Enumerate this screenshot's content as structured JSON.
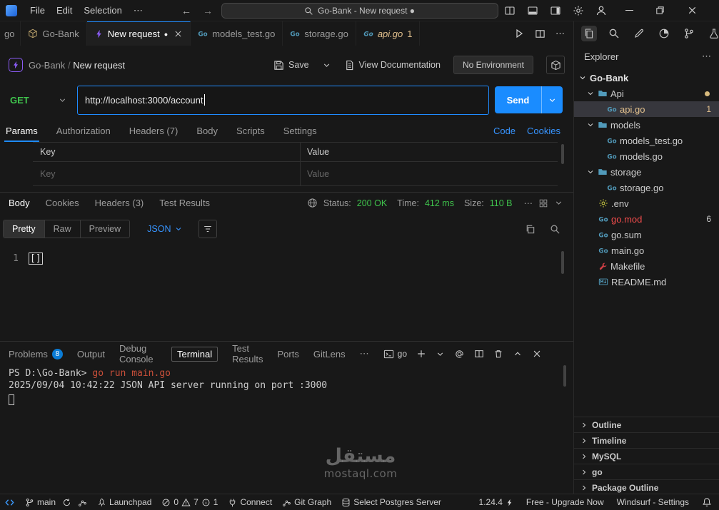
{
  "glyphs": {
    "ellipsis": "⋯",
    "back": "←",
    "forward": "→"
  },
  "colors": {
    "accent_blue": "#1f8bff",
    "link_blue": "#3794ff",
    "green": "#3fc24c",
    "gold_modified": "#e2c08d",
    "error_red": "#f14c4c",
    "purple_bolt": "#8b5cf6",
    "file_icon_blue": "#519aba",
    "env_yellow": "#cbcb41",
    "makefile_red": "#cc3e44"
  },
  "titlebar": {
    "menus": [
      "File",
      "Edit",
      "Selection"
    ],
    "search_text": "Go-Bank - New request ●"
  },
  "editor_tabs": {
    "overflow_fragment": "go",
    "tabs": [
      {
        "label": "Go-Bank"
      },
      {
        "label": "New request",
        "modified": "●"
      },
      {
        "label": "models_test.go"
      },
      {
        "label": "storage.go"
      },
      {
        "label": "api.go",
        "badge": "1"
      }
    ]
  },
  "header": {
    "breadcrumb_project": "Go-Bank",
    "breadcrumb_separator": "/",
    "breadcrumb_page": "New request",
    "save_label": "Save",
    "view_documentation_label": "View Documentation",
    "environment_label": "No Environment"
  },
  "request": {
    "method": "GET",
    "url": "http://localhost:3000/account",
    "send_label": "Send"
  },
  "request_tabs": {
    "tabs": [
      "Params",
      "Authorization",
      "Headers (7)",
      "Body",
      "Scripts",
      "Settings"
    ],
    "code_link": "Code",
    "cookies_link": "Cookies"
  },
  "params_table": {
    "key_header": "Key",
    "value_header": "Value",
    "key_placeholder": "Key",
    "value_placeholder": "Value"
  },
  "response": {
    "tabs": [
      "Body",
      "Cookies",
      "Headers (3)",
      "Test Results"
    ],
    "status_label": "Status:",
    "status_value": "200 OK",
    "time_label": "Time:",
    "time_value": "412 ms",
    "size_label": "Size:",
    "size_value": "110 B",
    "view_modes": [
      "Pretty",
      "Raw",
      "Preview"
    ],
    "format_selector": "JSON",
    "line_number": "1",
    "body_text": "[]"
  },
  "bottom_panel": {
    "tabs": [
      "Problems",
      "Output",
      "Debug Console",
      "Terminal",
      "Test Results",
      "Ports",
      "GitLens"
    ],
    "problems_badge": "8",
    "shell_label": "go",
    "terminal": {
      "prompt": "PS D:\\Go-Bank> ",
      "command": "go run main.go",
      "log_line": "2025/09/04 10:42:22 JSON API server running on port :3000"
    }
  },
  "explorer": {
    "title": "Explorer",
    "root": "Go-Bank",
    "items": [
      {
        "label": "Api"
      },
      {
        "label": "api.go",
        "badge": "1"
      },
      {
        "label": "models"
      },
      {
        "label": "models_test.go"
      },
      {
        "label": "models.go"
      },
      {
        "label": "storage"
      },
      {
        "label": "storage.go"
      },
      {
        "label": ".env"
      },
      {
        "label": "go.mod",
        "badge": "6"
      },
      {
        "label": "go.sum"
      },
      {
        "label": "main.go"
      },
      {
        "label": "Makefile"
      },
      {
        "label": "README.md"
      }
    ],
    "sections": [
      "Outline",
      "Timeline",
      "MySQL",
      "go",
      "Package Outline"
    ]
  },
  "statusbar": {
    "branch": "main",
    "launchpad": "Launchpad",
    "errors": "0",
    "warnings": "7",
    "infos": "1",
    "connect": "Connect",
    "git_graph": "Git Graph",
    "postgres": "Select Postgres Server",
    "go_version": "1.24.4",
    "plan": "Free - Upgrade Now",
    "app_settings": "Windsurf - Settings"
  },
  "watermark": {
    "line1": "مستقل",
    "line2": "mostaql.com"
  }
}
